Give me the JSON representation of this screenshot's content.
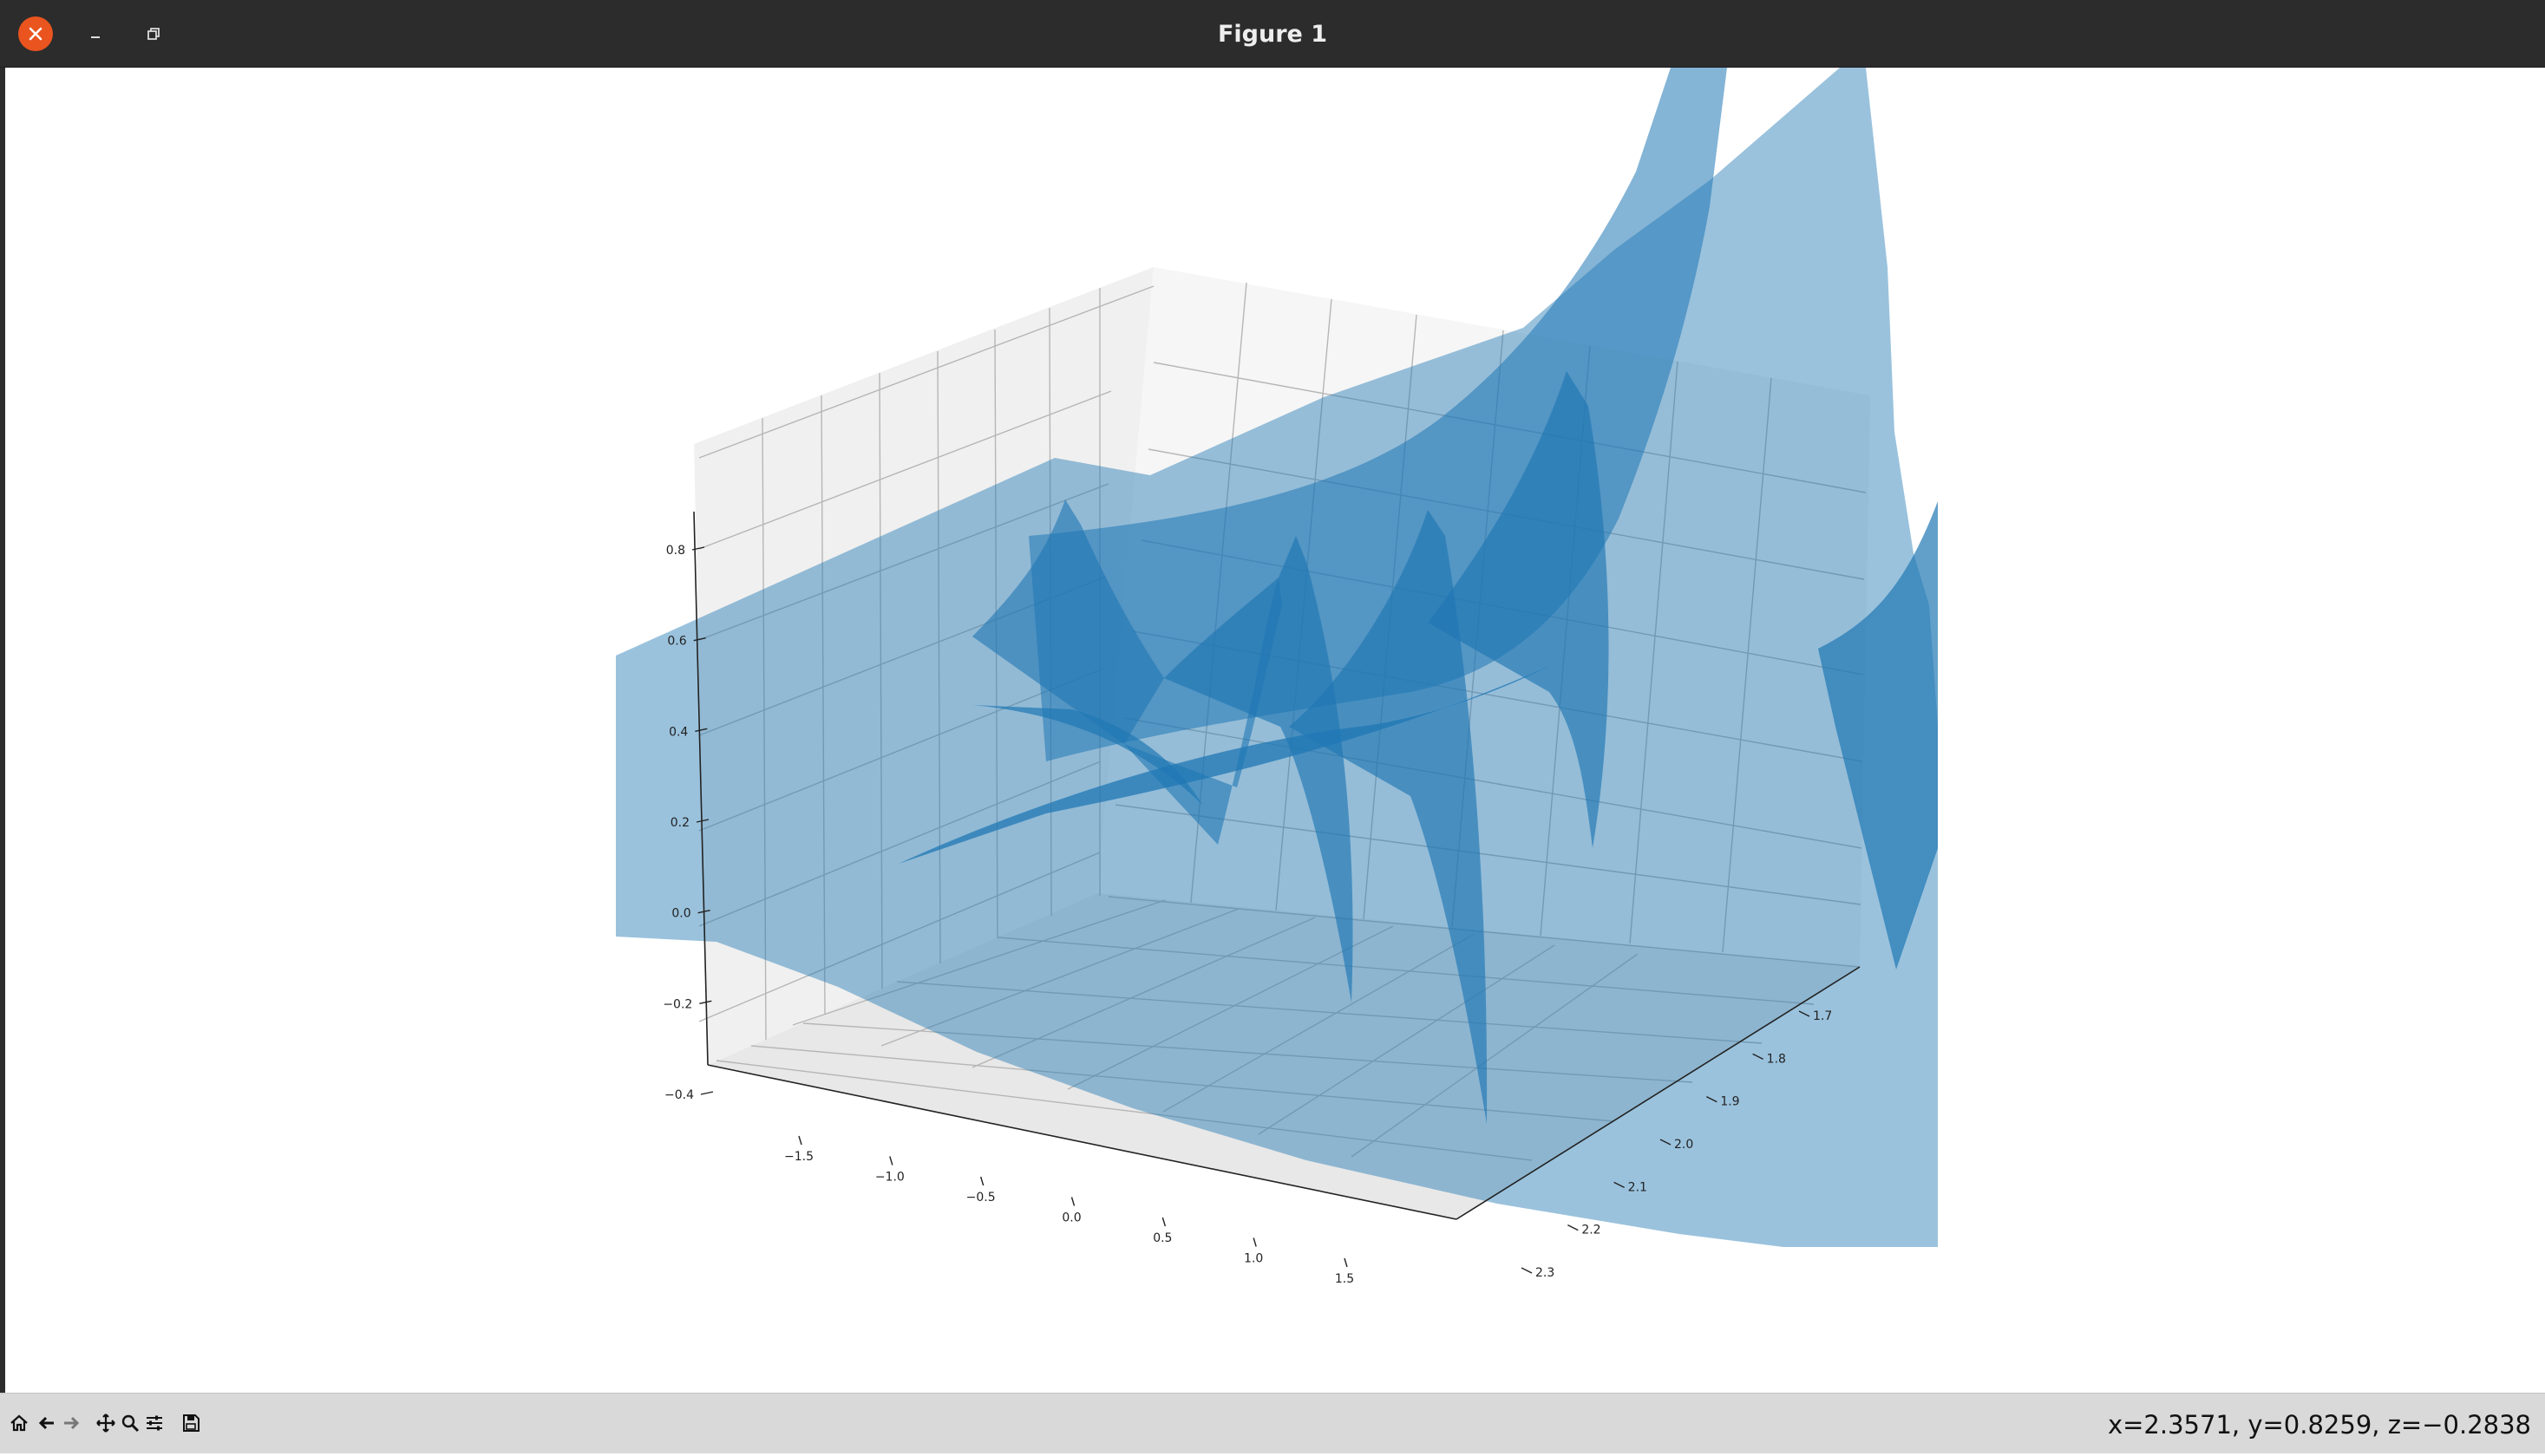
{
  "window": {
    "title": "Figure 1",
    "controls": [
      "close",
      "minimize",
      "restore"
    ]
  },
  "toolbar": {
    "tools": [
      "home-icon",
      "back-arrow-icon",
      "forward-arrow-icon",
      "pan-icon",
      "zoom-icon",
      "configure-subplots-icon",
      "save-icon"
    ],
    "coordinates": "x=2.3571, y=0.8259, z=−0.2838"
  },
  "colors": {
    "titlebar": "#2c2c2c",
    "close_button": "#e9541f",
    "toolbar": "#d9d9d9",
    "surface": "#1f77b4"
  },
  "chart_data": {
    "type": "surface3d",
    "title": "",
    "x_ticks": [
      "−1.5",
      "−1.0",
      "−0.5",
      "0.0",
      "0.5",
      "1.0",
      "1.5"
    ],
    "y_ticks": [
      "1.7",
      "1.8",
      "1.9",
      "2.0",
      "2.1",
      "2.2",
      "2.3"
    ],
    "z_ticks": [
      "−0.4",
      "−0.2",
      "0.0",
      "0.2",
      "0.4",
      "0.6",
      "0.8"
    ],
    "xlim": [
      -1.8,
      1.8
    ],
    "ylim": [
      1.65,
      2.35
    ],
    "zlim": [
      -0.45,
      0.85
    ],
    "grid": true
  }
}
